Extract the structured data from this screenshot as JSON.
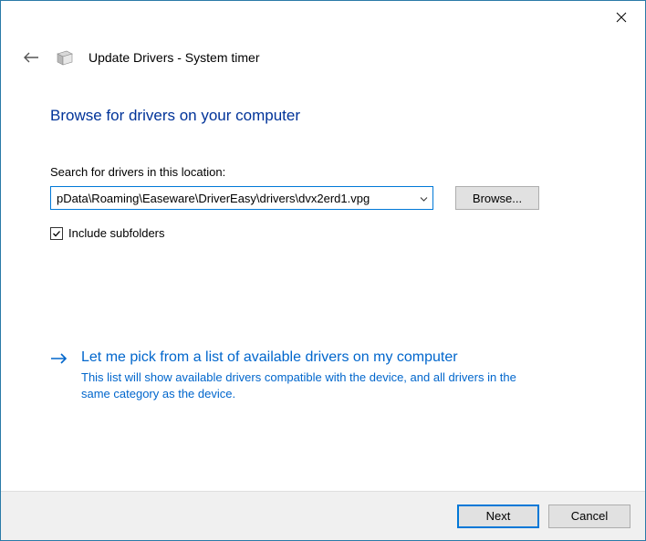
{
  "window": {
    "title": "Update Drivers - System timer"
  },
  "heading": "Browse for drivers on your computer",
  "search": {
    "label": "Search for drivers in this location:",
    "path": "pData\\Roaming\\Easeware\\DriverEasy\\drivers\\dvx2erd1.vpg",
    "browse_label": "Browse..."
  },
  "subfolders": {
    "label": "Include subfolders",
    "checked": true
  },
  "pick": {
    "title": "Let me pick from a list of available drivers on my computer",
    "desc": "This list will show available drivers compatible with the device, and all drivers in the same category as the device."
  },
  "footer": {
    "next": "Next",
    "cancel": "Cancel"
  }
}
